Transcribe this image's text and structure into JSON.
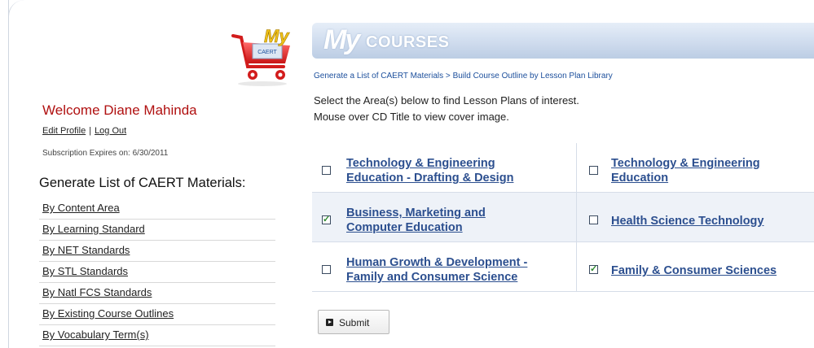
{
  "user": {
    "welcome": "Welcome Diane Mahinda",
    "edit_profile": "Edit Profile",
    "separator": "|",
    "log_out": "Log Out",
    "subscription": "Subscription Expires on: 6/30/2011"
  },
  "logo": {
    "text": "CAERT",
    "my": "My"
  },
  "sidebar": {
    "heading": "Generate List of CAERT Materials:",
    "items": [
      {
        "label": "By Content Area"
      },
      {
        "label": "By Learning Standard"
      },
      {
        "label": "By NET Standards"
      },
      {
        "label": "By STL Standards"
      },
      {
        "label": "By Natl FCS Standards"
      },
      {
        "label": "By Existing Course Outlines"
      },
      {
        "label": "By Vocabulary Term(s)"
      }
    ]
  },
  "banner": {
    "my": "My",
    "courses": "COURSES"
  },
  "breadcrumb": {
    "part1": "Generate a List of CAERT Materials",
    "sep": " > ",
    "part2": "Build Course Outline by Lesson Plan Library"
  },
  "instructions": {
    "line1": "Select the Area(s) below to find Lesson Plans of interest.",
    "line2": "Mouse over CD Title to view cover image."
  },
  "areas": [
    {
      "line1": "Technology & Engineering",
      "line2": "Education - Drafting & Design",
      "checked": false
    },
    {
      "line1": "Technology & Engineering",
      "line2": "Education",
      "checked": false
    },
    {
      "line1": "Business, Marketing and",
      "line2": "Computer Education",
      "checked": true
    },
    {
      "line1": "Health Science Technology",
      "line2": "",
      "checked": false
    },
    {
      "line1": "Human Growth & Development -",
      "line2": "Family and Consumer Science",
      "checked": false
    },
    {
      "line1": "Family & Consumer Sciences",
      "line2": "",
      "checked": true
    }
  ],
  "submit": {
    "label": "Submit"
  },
  "colors": {
    "accent_red": "#b01010",
    "link_blue": "#2c4f8f",
    "banner_blue": "#cfdcee"
  }
}
